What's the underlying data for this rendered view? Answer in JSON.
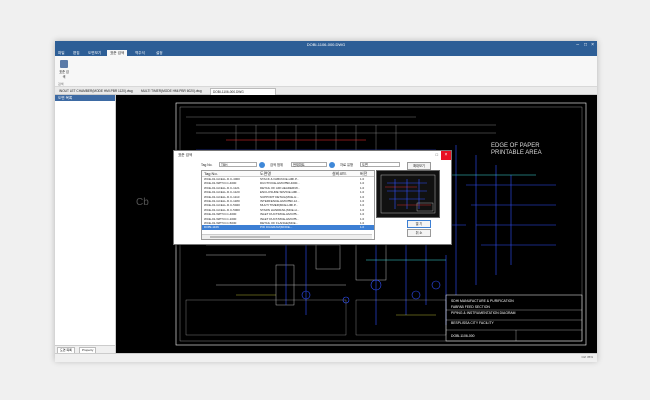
{
  "window": {
    "title": "DOBI-1106-000.DWG"
  },
  "ribbon_tabs": [
    "파일",
    "편집",
    "도면보기",
    "표준 검색",
    "역주석",
    "설정"
  ],
  "ribbon_active_index": 3,
  "ribbon": {
    "button_label": "표준 검색",
    "group_label": "검색"
  },
  "document_tabs": [
    "INOUT LET CHAMBER(MODE HMI.PBR 1120).dwg",
    "MULTI TIMER(MODE HMI.PBR 6020).dwg",
    "DOBI-1106-000.DWG"
  ],
  "document_active_index": 2,
  "sidebar": {
    "header": "도면 목록",
    "tabs": [
      "도면 목록",
      "Property"
    ]
  },
  "status": {
    "text": "Ctrl 35%"
  },
  "drawing": {
    "corner_note": "EDGE OF PAPER\nPRINTABLE AREA",
    "title_block": [
      "SDHI MANUFACTURE & PURIFICATION",
      "FABFAB FEED SECTION",
      "PIPING & INSTRUMENTATION DIAGRAM",
      "BESPLISSA CITY FACILITY"
    ],
    "drawing_no": "DOBI-1106-000"
  },
  "dialog": {
    "title": "표준 검색",
    "tag_label": "Tag No.",
    "tag_value": "TBH",
    "scope_label": "검색 범위",
    "scope_value": "현재파트",
    "type_label": "자료 유형",
    "type_value": "도면",
    "columns": [
      "Tag No.",
      "도면명",
      "설비코드",
      "버전"
    ],
    "rows": [
      [
        "WCE-01-GCELL.D.C-4000",
        "STACK & FABCNCE-HMI.P...",
        "",
        "1.0"
      ],
      [
        "WCE-01-WPT.D.C-4000",
        "DUCTIVICE-HMI.PBR-4000...",
        "",
        "1.0"
      ],
      [
        "WCE-01-GCELL.D.C-1121",
        "DETAIL OF AIR HEADER/W...",
        "",
        "1.0"
      ],
      [
        "WCE-01-GCELL.D.C-1120",
        "ENCLOSURE SRVICE-HMI...",
        "",
        "1.0"
      ],
      [
        "WCE-01-GCELL.D.C-1110",
        "SUPPORT DETAIL(MCE-H...",
        "",
        "1.0"
      ],
      [
        "WCE-01-GCELL.D.C-1180",
        "INTERFENCE-HMI.PBR-12...",
        "",
        "1.0"
      ],
      [
        "WCE-01-GCELL.D.C-5020",
        "MULTI TIMER(MCE-HMI.P...",
        "",
        "1.0"
      ],
      [
        "WCE-01-GCELL.D.C-5000",
        "STARN HANDRAIL(MCE-H...",
        "",
        "1.0"
      ],
      [
        "WCE-01-WPT.D.C-4000",
        "INLET DUCTIMCE-HMI.PB...",
        "",
        "1.0"
      ],
      [
        "WCE-01-WPT.D.C-1000",
        "INLET DUCT/MCE-HMI.PB...",
        "",
        "1.0"
      ],
      [
        "WCE-01-WPT.D.C-5030",
        "DETAIL OF FLANGE(MCE...",
        "",
        "1.0"
      ],
      [
        "DOBI-1106",
        "PID DIAGRAM(MODE...",
        "",
        "1.0"
      ]
    ],
    "selected_row": 11,
    "buttons": [
      "열 기",
      "취 소"
    ],
    "preview_button": "확대보기"
  }
}
